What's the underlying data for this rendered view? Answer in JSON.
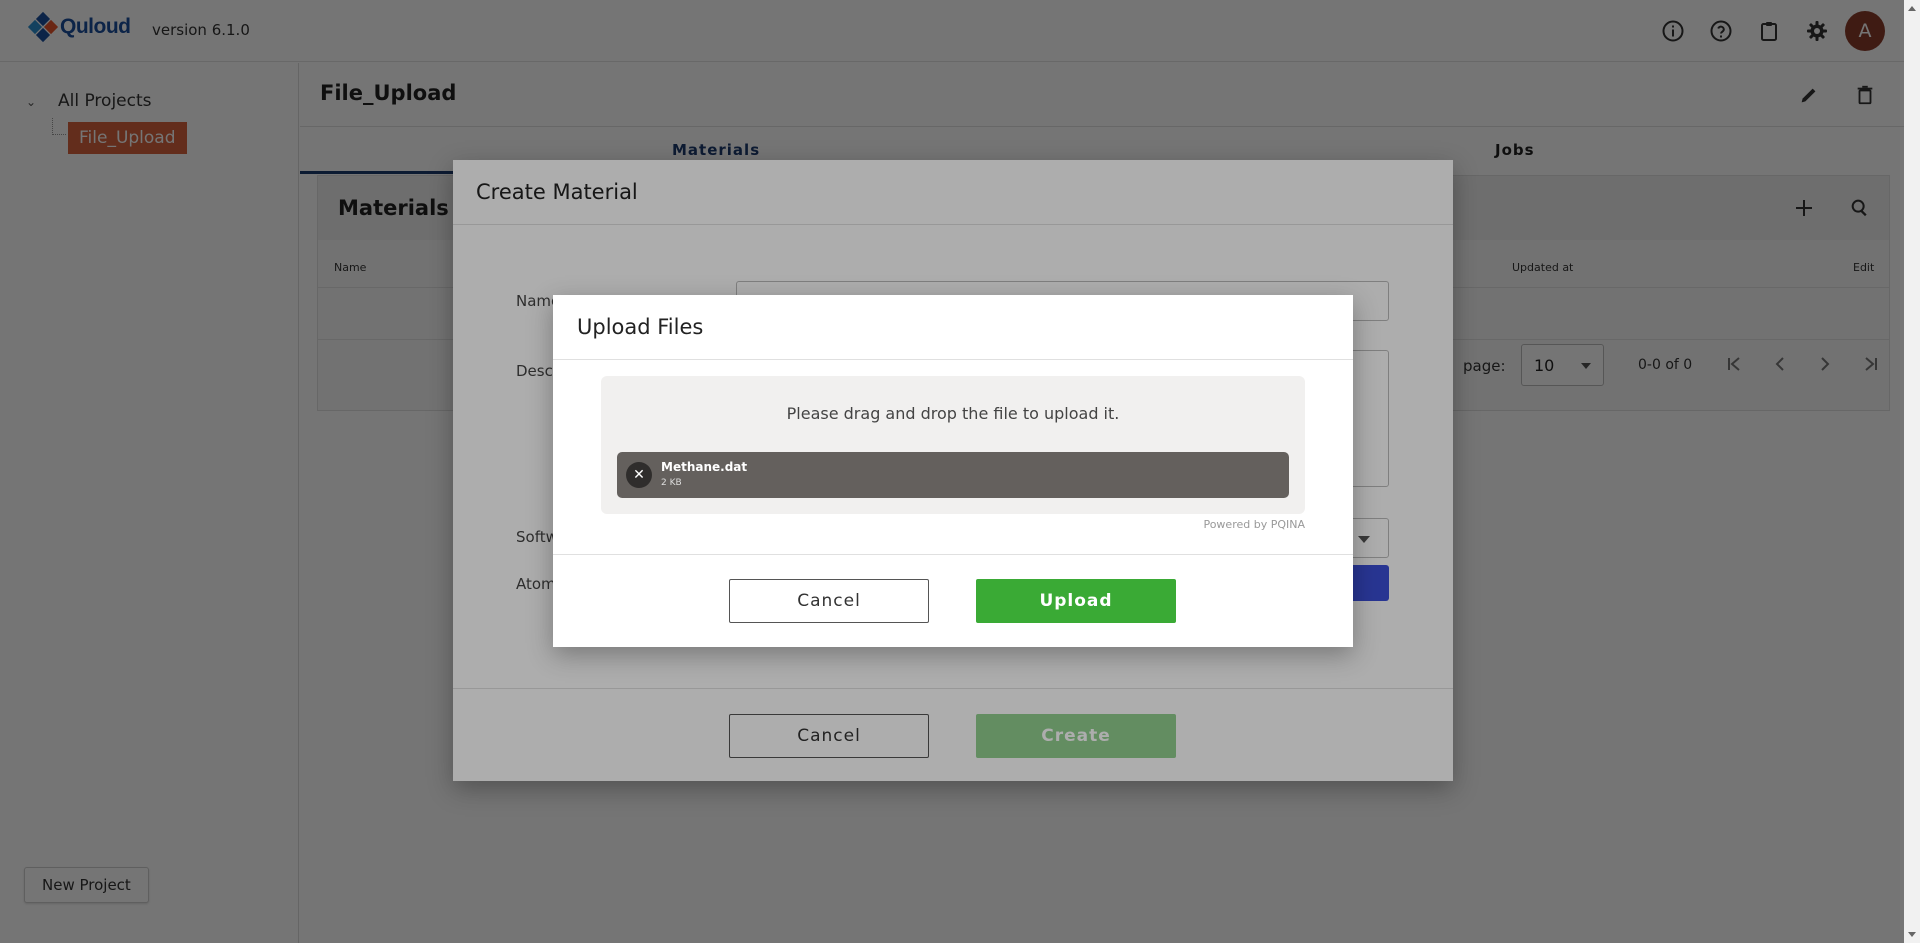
{
  "app": {
    "logo_text": "Quloud",
    "version": "version 6.1.0",
    "user_initial": "A",
    "icons": [
      "info-icon",
      "help-icon",
      "clipboard-icon",
      "gear-icon"
    ]
  },
  "sidebar": {
    "root_label": "All Projects",
    "child_label": "File_Upload",
    "new_project_label": "New Project"
  },
  "page": {
    "title": "File_Upload",
    "tabs": [
      {
        "label": "Materials",
        "active": true
      },
      {
        "label": "Jobs",
        "active": false
      }
    ]
  },
  "materials_card": {
    "title": "Materials",
    "columns": {
      "name": "Name",
      "updated_at": "Updated at",
      "edit": "Edit"
    },
    "pagination": {
      "rows_per_page_label": "page:",
      "rows_per_page_value": "10",
      "range": "0-0 of 0"
    }
  },
  "create_material_dialog": {
    "title": "Create Material",
    "labels": {
      "name": "Name",
      "description": "Descr",
      "software": "Softw",
      "atoms": "Atom"
    },
    "cancel_label": "Cancel",
    "create_label": "Create"
  },
  "upload_dialog": {
    "title": "Upload Files",
    "drop_text": "Please drag and drop the file to upload it.",
    "file": {
      "name": "Methane.dat",
      "size": "2 KB"
    },
    "powered_by": "Powered by PQINA",
    "cancel_label": "Cancel",
    "upload_label": "Upload"
  },
  "colors": {
    "accent_orange": "#d9633f",
    "primary_blue": "#3b4fd8",
    "success_green": "#3aaa35",
    "brand_navy": "#1d4e9c"
  }
}
